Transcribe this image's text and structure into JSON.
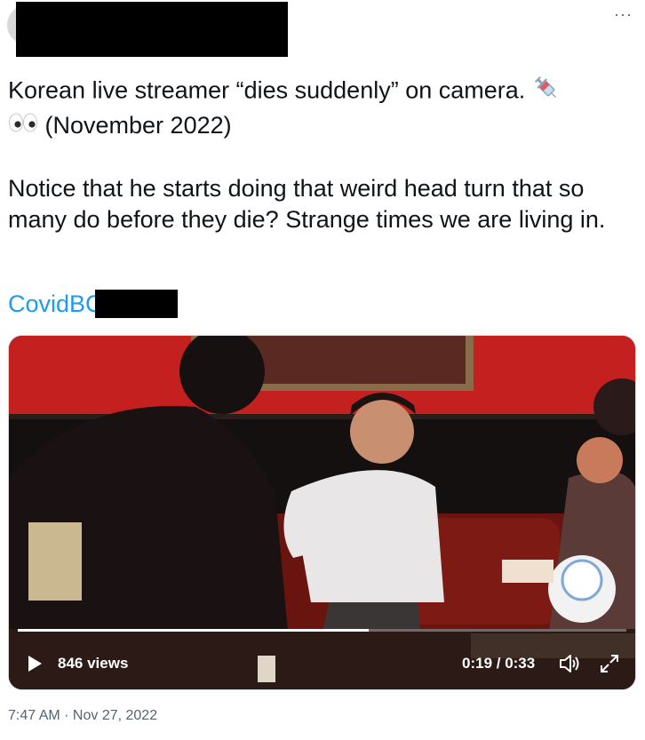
{
  "tweet": {
    "more_icon": "more-options-icon",
    "line1": "Korean live streamer “dies suddenly” on camera.",
    "line1_emoji": "syringe-emoji",
    "line2_emoji": "eyes-emoji",
    "line2": "(November 2022)",
    "para2": "Notice that he starts doing that weird head turn that so many do before they die? Strange times we are living in.",
    "link_visible": "CovidBC"
  },
  "video": {
    "views": "846 views",
    "time": "0:19 / 0:33",
    "progress_fraction": 0.576,
    "play_icon": "play-icon",
    "volume_icon": "volume-icon",
    "fullscreen_icon": "fullscreen-icon"
  },
  "meta": {
    "timestamp": "7:47 AM · Nov 27, 2022"
  },
  "colors": {
    "link": "#1d9bf0",
    "secondary_text": "#536471",
    "primary_text": "#0f1419"
  }
}
